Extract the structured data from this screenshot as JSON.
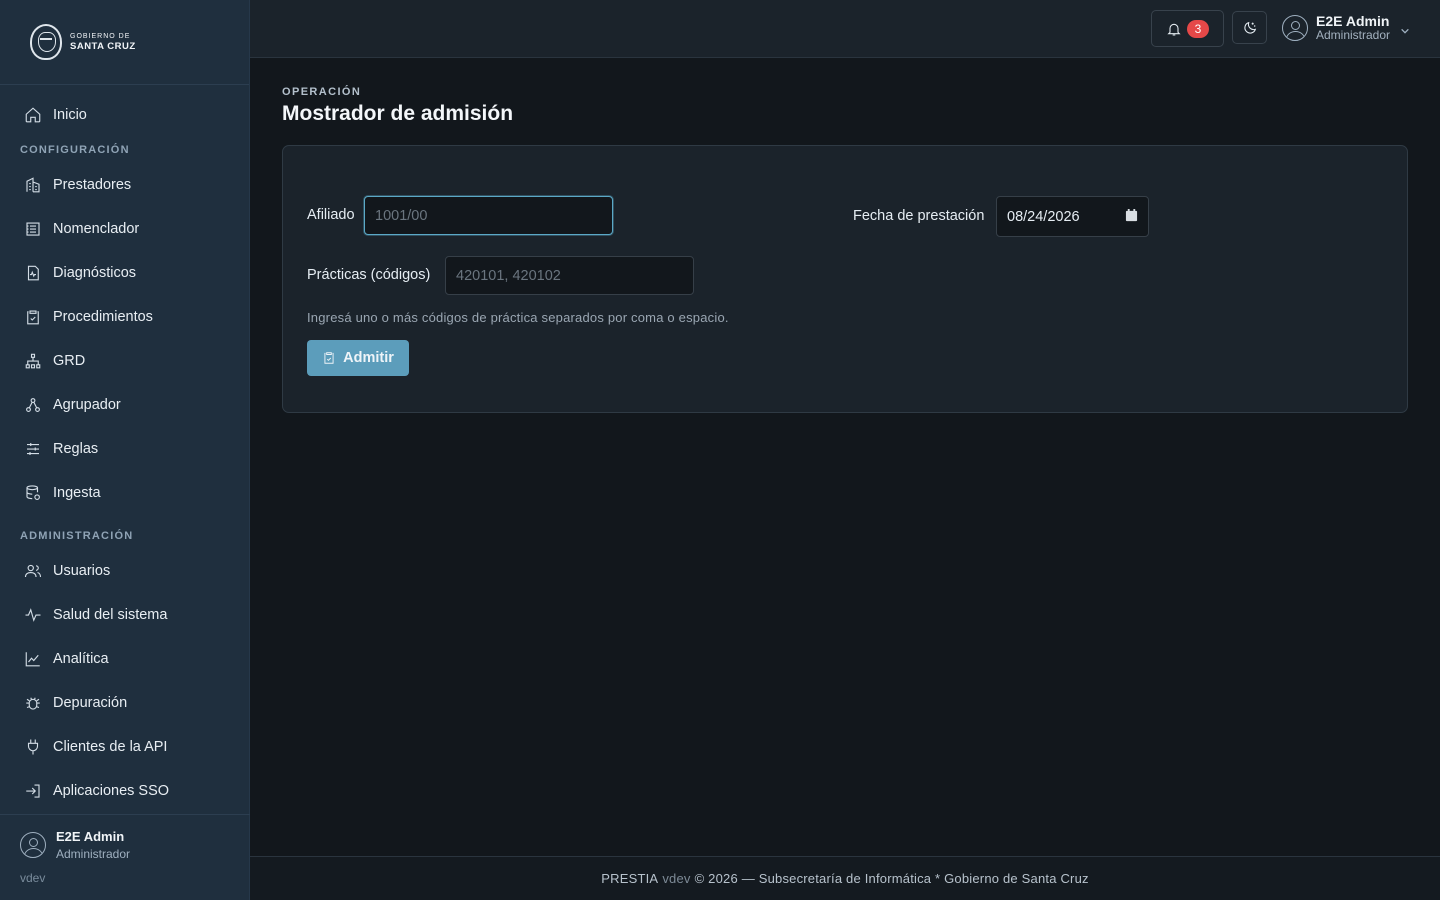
{
  "brand": {
    "line1": "GOBIERNO DE",
    "line2": "SANTA CRUZ"
  },
  "sidebar": {
    "home": {
      "label": "Inicio",
      "icon": "home-icon"
    },
    "section_config": "CONFIGURACIÓN",
    "config_items": [
      {
        "label": "Prestadores",
        "icon": "building-icon"
      },
      {
        "label": "Nomenclador",
        "icon": "list-icon"
      },
      {
        "label": "Diagnósticos",
        "icon": "file-pulse-icon"
      },
      {
        "label": "Procedimientos",
        "icon": "clipboard-check-icon"
      },
      {
        "label": "GRD",
        "icon": "hierarchy-icon"
      },
      {
        "label": "Agrupador",
        "icon": "network-icon"
      },
      {
        "label": "Reglas",
        "icon": "sliders-icon"
      },
      {
        "label": "Ingesta",
        "icon": "database-icon"
      }
    ],
    "section_admin": "ADMINISTRACIÓN",
    "admin_items": [
      {
        "label": "Usuarios",
        "icon": "users-icon"
      },
      {
        "label": "Salud del sistema",
        "icon": "activity-icon"
      },
      {
        "label": "Analítica",
        "icon": "chart-line-icon"
      },
      {
        "label": "Depuración",
        "icon": "bug-icon"
      },
      {
        "label": "Clientes de la API",
        "icon": "plug-icon"
      },
      {
        "label": "Aplicaciones SSO",
        "icon": "login-icon"
      }
    ],
    "user": {
      "name": "E2E Admin",
      "role": "Administrador"
    },
    "version": "vdev"
  },
  "header": {
    "notifications_count": "3",
    "user": {
      "name": "E2E Admin",
      "role": "Administrador"
    }
  },
  "main": {
    "eyebrow": "OPERACIÓN",
    "title": "Mostrador de admisión",
    "form": {
      "afiliado_label": "Afiliado",
      "afiliado_placeholder": "1001/00",
      "fecha_label": "Fecha de prestación",
      "fecha_value": "08/24/2026",
      "practicas_label": "Prácticas (códigos)",
      "practicas_placeholder": "420101, 420102",
      "help": "Ingresá uno o más códigos de práctica separados por coma o espacio.",
      "submit": "Admitir"
    }
  },
  "footer": {
    "app": "PRESTIA",
    "version": "vdev",
    "rest": "© 2026 — Subsecretaría de Informática * Gobierno de Santa Cruz"
  },
  "colors": {
    "accent": "#5c9dbb",
    "sidebar_bg": "#1f2f3e",
    "badge": "#e54848"
  }
}
